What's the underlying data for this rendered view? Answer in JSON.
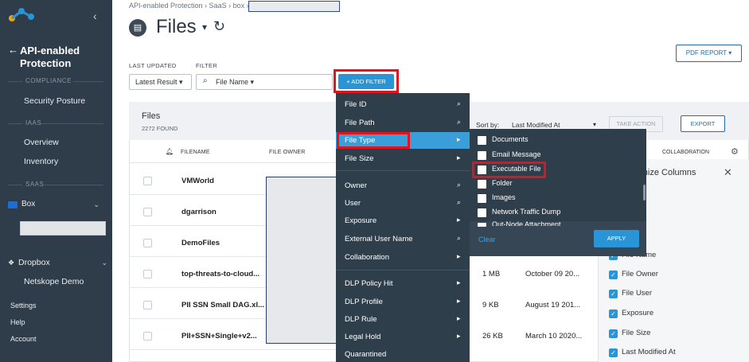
{
  "sidebar": {
    "back_title": "API-enabled Protection",
    "compliance_label": "COMPLIANCE",
    "security_posture": "Security Posture",
    "iaas_label": "IAAS",
    "overview": "Overview",
    "inventory": "Inventory",
    "saas_label": "SAAS",
    "box": "Box",
    "dropbox": "Dropbox",
    "netskope_demo": "Netskope Demo",
    "settings": "Settings",
    "help": "Help",
    "account": "Account"
  },
  "header": {
    "breadcrumb": "API-enabled Protection › SaaS › box ›",
    "title": "Files",
    "pdf_report": "PDF REPORT"
  },
  "filters": {
    "last_updated_label": "LAST UPDATED",
    "filter_label": "FILTER",
    "latest_result": "Latest Result",
    "file_name": "File Name",
    "add_filter": "+ ADD FILTER"
  },
  "files": {
    "title": "Files",
    "count": "2272 FOUND",
    "sort_by_label": "Sort by:",
    "sort_by_value": "Last Modified At",
    "take_action": "TAKE ACTION",
    "export": "EXPORT",
    "columns": {
      "filename": "FILENAME",
      "file_owner": "FILE OWNER",
      "collaboration": "COLLABORATION"
    },
    "rows": [
      {
        "name": "VMWorld",
        "size": "",
        "date": ""
      },
      {
        "name": "dgarrison",
        "size": "",
        "date": ""
      },
      {
        "name": "DemoFiles",
        "size": "",
        "date": ""
      },
      {
        "name": "top-threats-to-cloud...",
        "size": "1 MB",
        "date": "October 09 20..."
      },
      {
        "name": "PII SSN Small DAG.xl...",
        "size": "9 KB",
        "date": "August 19 201..."
      },
      {
        "name": "PII+SSN+Single+v2...",
        "size": "26 KB",
        "date": "March 10 2020..."
      }
    ]
  },
  "customize_columns": {
    "title": "Customize Columns",
    "items": [
      "File Name",
      "File Owner",
      "File User",
      "Exposure",
      "File Size",
      "Last Modified At"
    ]
  },
  "filter_menu": {
    "items": [
      "File ID",
      "File Path",
      "File Type",
      "File Size",
      "Owner",
      "User",
      "Exposure",
      "External User Name",
      "Collaboration",
      "DLP Policy Hit",
      "DLP Profile",
      "DLP Rule",
      "Legal Hold",
      "Quarantined"
    ]
  },
  "file_type_submenu": {
    "options": [
      "Documents",
      "Email Message",
      "Executable File",
      "Folder",
      "Images",
      "Network Traffic Dump",
      "Out-Node Attachment"
    ],
    "clear": "Clear",
    "apply": "APPLY"
  }
}
